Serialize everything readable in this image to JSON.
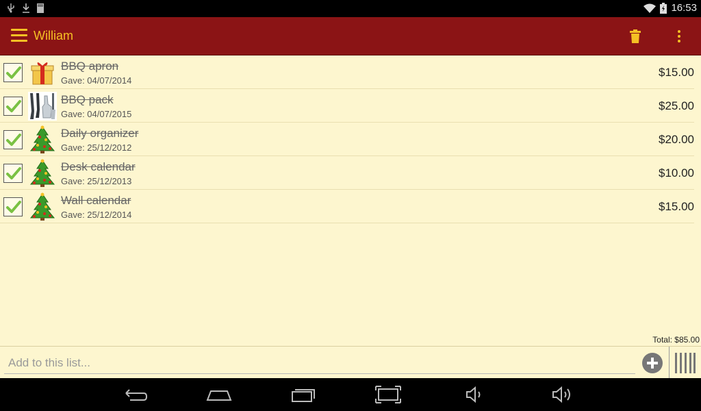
{
  "status_bar": {
    "time": "16:53",
    "left_icons": [
      "usb-icon",
      "download-icon",
      "sdcard-icon"
    ],
    "right_icons": [
      "wifi-icon",
      "battery-icon"
    ]
  },
  "action_bar": {
    "title": "William",
    "background": "#8b1415",
    "accent": "#f5c024",
    "icons": [
      "menu-icon",
      "trash-icon",
      "overflow-menu-icon"
    ]
  },
  "items": [
    {
      "name": "BBQ apron",
      "date": "Gave: 04/07/2014",
      "price": "$15.00",
      "checked": true,
      "icon": "gift-icon"
    },
    {
      "name": "BBQ pack",
      "date": "Gave: 04/07/2015",
      "price": "$25.00",
      "checked": true,
      "icon": "bbq-tools-image"
    },
    {
      "name": "Daily organizer",
      "date": "Gave: 25/12/2012",
      "price": "$20.00",
      "checked": true,
      "icon": "christmas-tree-icon"
    },
    {
      "name": "Desk calendar",
      "date": "Gave: 25/12/2013",
      "price": "$10.00",
      "checked": true,
      "icon": "christmas-tree-icon"
    },
    {
      "name": "Wall calendar",
      "date": "Gave: 25/12/2014",
      "price": "$15.00",
      "checked": true,
      "icon": "christmas-tree-icon"
    }
  ],
  "total": "Total: $85.00",
  "add_bar": {
    "placeholder": "Add to this list...",
    "value": "",
    "icons": [
      "add-circle-icon",
      "barcode-icon"
    ]
  },
  "nav_bar": {
    "icons": [
      "back-icon",
      "home-icon",
      "recent-apps-icon",
      "screenshot-icon",
      "volume-down-icon",
      "volume-up-icon"
    ]
  }
}
